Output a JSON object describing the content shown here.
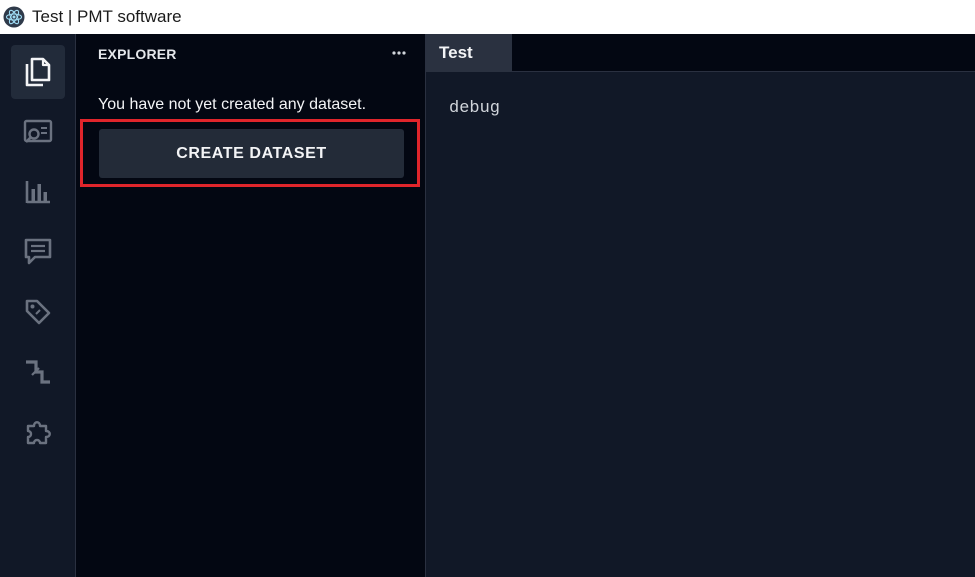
{
  "window": {
    "title": "Test | PMT software",
    "logo_icon": "electron-logo-icon"
  },
  "activity_bar": {
    "items": [
      {
        "name": "explorer",
        "icon": "files-icon",
        "active": true
      },
      {
        "name": "search",
        "icon": "search-preview-icon",
        "active": false
      },
      {
        "name": "charts",
        "icon": "bar-chart-icon",
        "active": false
      },
      {
        "name": "comments",
        "icon": "comment-icon",
        "active": false
      },
      {
        "name": "tags",
        "icon": "tag-icon",
        "active": false
      },
      {
        "name": "flow",
        "icon": "step-flow-icon",
        "active": false
      },
      {
        "name": "extensions",
        "icon": "puzzle-icon",
        "active": false
      }
    ]
  },
  "sidebar": {
    "header": "EXPLORER",
    "more_icon": "ellipsis-icon",
    "empty_message": "You have not yet created any dataset.",
    "create_button_label": "CREATE DATASET",
    "highlight_color": "#e0252b"
  },
  "editor": {
    "tab_label": "Test",
    "content": "debug"
  },
  "colors": {
    "activity_bg": "#111827",
    "sidebar_bg": "#030712",
    "editor_bg": "#111827",
    "button_bg": "#232b38",
    "icon": "#6b7280"
  }
}
